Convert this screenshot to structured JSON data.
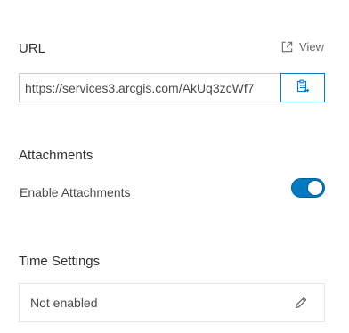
{
  "url_section": {
    "title": "URL",
    "view_label": "View",
    "url_value": "https://services3.arcgis.com/AkUq3zcWf7",
    "icons": {
      "view": "external-link-icon",
      "copy": "copy-clipboard-icon"
    }
  },
  "attachments_section": {
    "title": "Attachments",
    "toggle_label": "Enable Attachments",
    "enabled": true
  },
  "time_section": {
    "title": "Time Settings",
    "status_text": "Not enabled",
    "edit_icon": "pencil-icon"
  },
  "colors": {
    "accent": "#007ac2",
    "text": "#323232",
    "muted": "#6a6a6a",
    "border": "#c9c9c9"
  }
}
